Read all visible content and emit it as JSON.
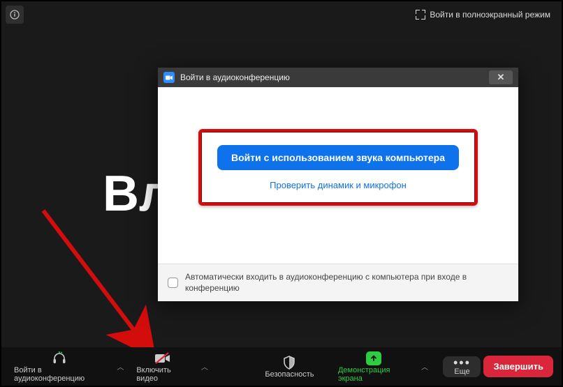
{
  "topbar": {
    "fullscreen_label": "Войти в полноэкранный режим"
  },
  "background": {
    "partial_text": "Вл"
  },
  "dialog": {
    "title": "Войти в аудиоконференцию",
    "primary_button": "Войти с использованием звука компьютера",
    "test_link": "Проверить динамик и микрофон",
    "auto_join_label": "Автоматически входить в аудиоконференцию с компьютера при входе в конференцию"
  },
  "toolbar": {
    "join_audio": "Войти в аудиоконференцию",
    "start_video": "Включить видео",
    "security": "Безопасность",
    "share_screen": "Демонстрация экрана",
    "more": "Еще",
    "end": "Завершить"
  }
}
